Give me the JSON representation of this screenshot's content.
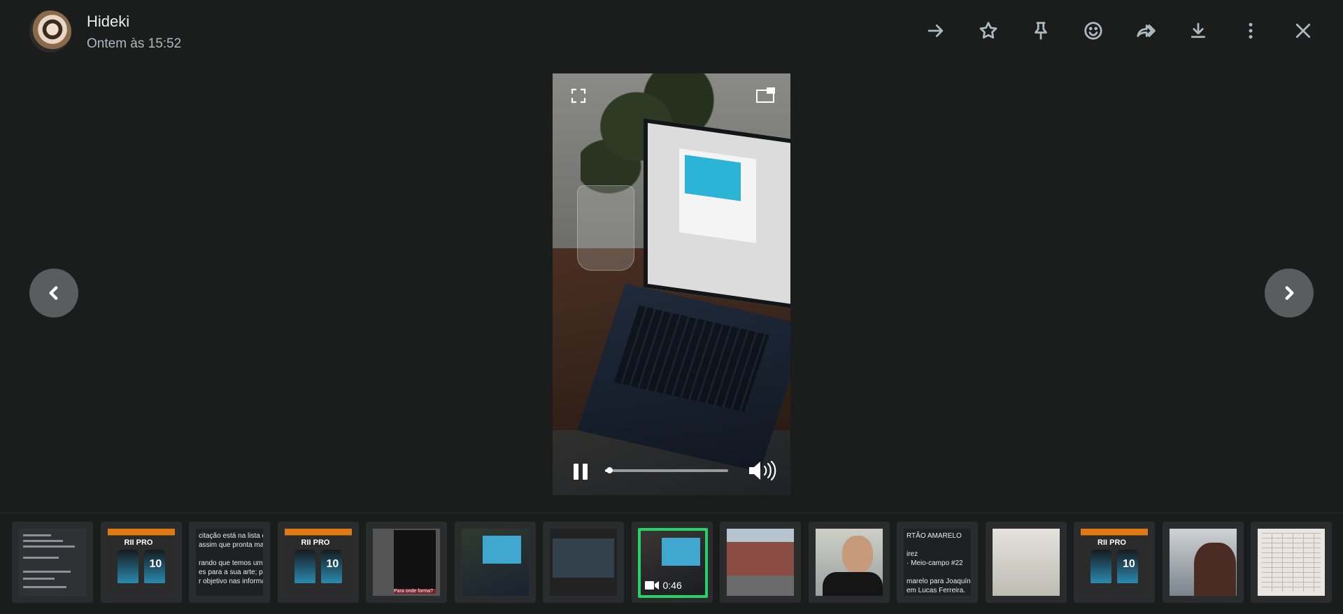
{
  "header": {
    "contact_name": "Hideki",
    "timestamp": "Ontem às 15:52",
    "icons": [
      "arrow-right-icon",
      "star-icon",
      "pin-icon",
      "emoji-icon",
      "forward-icon",
      "download-icon",
      "more-vertical-icon",
      "close-icon"
    ]
  },
  "video": {
    "state": "playing",
    "progress_fraction": 0.02,
    "controls": [
      "fullscreen-icon",
      "picture-in-picture-icon",
      "pause-icon",
      "volume-icon"
    ]
  },
  "thumbnails": [
    {
      "kind": "doc"
    },
    {
      "kind": "jersey",
      "logo": "RII PRO",
      "number": "10"
    },
    {
      "kind": "text",
      "lines": [
        "citação está na lista de",
        " assim que pronta mandare",
        "",
        "rando que temos um limite",
        "es para a sua arte; portanto",
        "r objetivo nas informações."
      ]
    },
    {
      "kind": "jersey",
      "logo": "RII PRO",
      "number": "10"
    },
    {
      "kind": "phone",
      "caption": "Para onde forma?"
    },
    {
      "kind": "laptop"
    },
    {
      "kind": "tv"
    },
    {
      "kind": "video",
      "duration": "0:46",
      "selected": true
    },
    {
      "kind": "building"
    },
    {
      "kind": "face"
    },
    {
      "kind": "text",
      "lines": [
        "RTÃO AMARELO",
        "",
        "irez",
        "· Meio-campo #22",
        "",
        "marelo para Joaquín Piquerez por",
        " em Lucas Ferreira."
      ]
    },
    {
      "kind": "white"
    },
    {
      "kind": "jersey",
      "logo": "RII PRO",
      "number": "10"
    },
    {
      "kind": "person"
    },
    {
      "kind": "paper"
    }
  ]
}
